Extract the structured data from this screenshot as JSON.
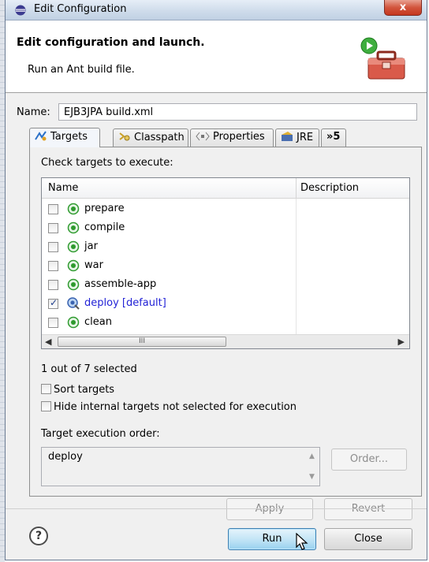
{
  "window": {
    "title": "Edit Configuration",
    "close_glyph": "x"
  },
  "header": {
    "title": "Edit configuration and launch.",
    "description": "Run an Ant build file.",
    "icon": "ant-toolbox-run-icon"
  },
  "name_field": {
    "label": "Name:",
    "value": "EJB3JPA build.xml"
  },
  "tabs": [
    {
      "label": "Targets",
      "icon": "targets-icon",
      "active": true
    },
    {
      "label": "Classpath",
      "icon": "classpath-icon",
      "active": false
    },
    {
      "label": "Properties",
      "icon": "properties-icon",
      "active": false
    },
    {
      "label": "JRE",
      "icon": "jre-icon",
      "active": false
    },
    {
      "label": "»5",
      "icon": "overflow-chevron-icon",
      "active": false
    }
  ],
  "targets_panel": {
    "check_label": "Check targets to execute:",
    "columns": {
      "name": "Name",
      "description": "Description"
    },
    "rows": [
      {
        "label": "prepare",
        "checked": false,
        "default": false
      },
      {
        "label": "compile",
        "checked": false,
        "default": false
      },
      {
        "label": "jar",
        "checked": false,
        "default": false
      },
      {
        "label": "war",
        "checked": false,
        "default": false
      },
      {
        "label": "assemble-app",
        "checked": false,
        "default": false
      },
      {
        "label": "deploy [default]",
        "checked": true,
        "default": true
      },
      {
        "label": "clean",
        "checked": false,
        "default": false
      }
    ],
    "scroll_thumb_glyph": "III",
    "selected_count_text": "1 out of 7 selected",
    "sort_targets_label": "Sort targets",
    "hide_internal_label": "Hide internal targets not selected for execution",
    "order_label": "Target execution order:",
    "order_value": "deploy",
    "order_button": "Order..."
  },
  "buttons": {
    "apply": "Apply",
    "revert": "Revert",
    "run": "Run",
    "close": "Close",
    "help": "?"
  },
  "colors": {
    "default_target": "#2323d6",
    "title_close": "#c4371f",
    "primary_button": "#98d1ef"
  }
}
